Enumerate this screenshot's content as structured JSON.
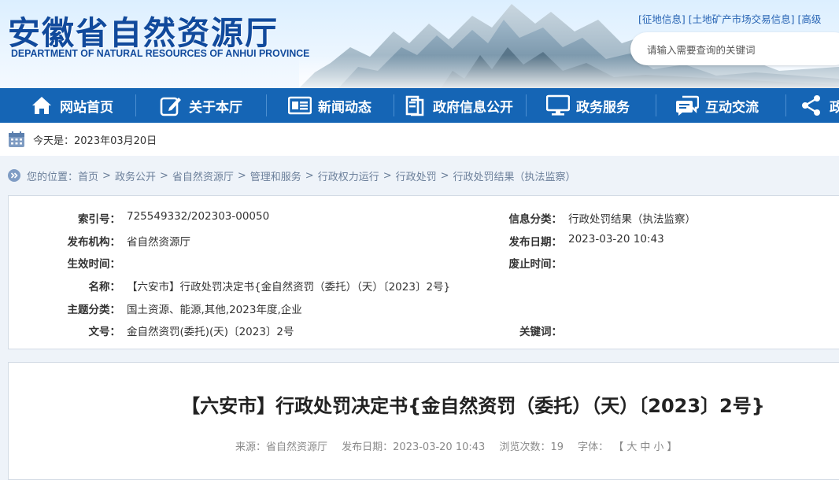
{
  "header": {
    "title": "安徽省自然资源厅",
    "subtitle": "DEPARTMENT OF NATURAL RESOURCES OF ANHUI PROVINCE",
    "top_links": [
      "[征地信息]",
      "[土地矿产市场交易信息]",
      "[高级"
    ],
    "search_placeholder": "请输入需要查询的关键词"
  },
  "nav": {
    "items": [
      {
        "label": "网站首页",
        "icon": "home-icon"
      },
      {
        "label": "关于本厅",
        "icon": "edit-icon"
      },
      {
        "label": "新闻动态",
        "icon": "newspaper-icon"
      },
      {
        "label": "政府信息公开",
        "icon": "document-icon"
      },
      {
        "label": "政务服务",
        "icon": "monitor-icon"
      },
      {
        "label": "互动交流",
        "icon": "chat-icon"
      },
      {
        "label": "政",
        "icon": "share-icon"
      }
    ]
  },
  "datebar": {
    "text": "今天是：2023年03月20日"
  },
  "breadcrumb": {
    "prefix": "您的位置：",
    "items": [
      "首页",
      "政务公开",
      "省自然资源厅",
      "管理和服务",
      "行政权力运行",
      "行政处罚",
      "行政处罚结果（执法监察）"
    ],
    "separator": ">"
  },
  "meta": {
    "index_label": "索引号：",
    "index_value": "725549332/202303-00050",
    "category_label": "信息分类：",
    "category_value": "行政处罚结果（执法监察）",
    "publisher_label": "发布机构：",
    "publisher_value": "省自然资源厅",
    "pubdate_label": "发布日期：",
    "pubdate_value": "2023-03-20 10:43",
    "effective_label": "生效时间：",
    "effective_value": "",
    "expire_label": "废止时间：",
    "expire_value": "",
    "name_label": "名称：",
    "name_value": "【六安市】行政处罚决定书{金自然资罚（委托）（天）〔2023〕2号}",
    "topic_label": "主题分类：",
    "topic_value": "国土资源、能源,其他,2023年度,企业",
    "docno_label": "文号：",
    "docno_value": "金自然资罚(委托)(天)〔2023〕2号",
    "keywords_label": "关键词：",
    "keywords_value": ""
  },
  "article": {
    "title": "【六安市】行政处罚决定书{金自然资罚（委托）（天）〔2023〕2号}",
    "source": "来源：省自然资源厅",
    "date": "发布日期：2023-03-20 10:43",
    "views": "浏览次数：19",
    "font_label": "字体：",
    "font_open": "【",
    "font_large": "大",
    "font_medium": "中",
    "font_small": "小",
    "font_close": "】"
  },
  "colors": {
    "nav_bg": "#1565b5",
    "brand": "#114a9c",
    "link": "#2864b4"
  }
}
